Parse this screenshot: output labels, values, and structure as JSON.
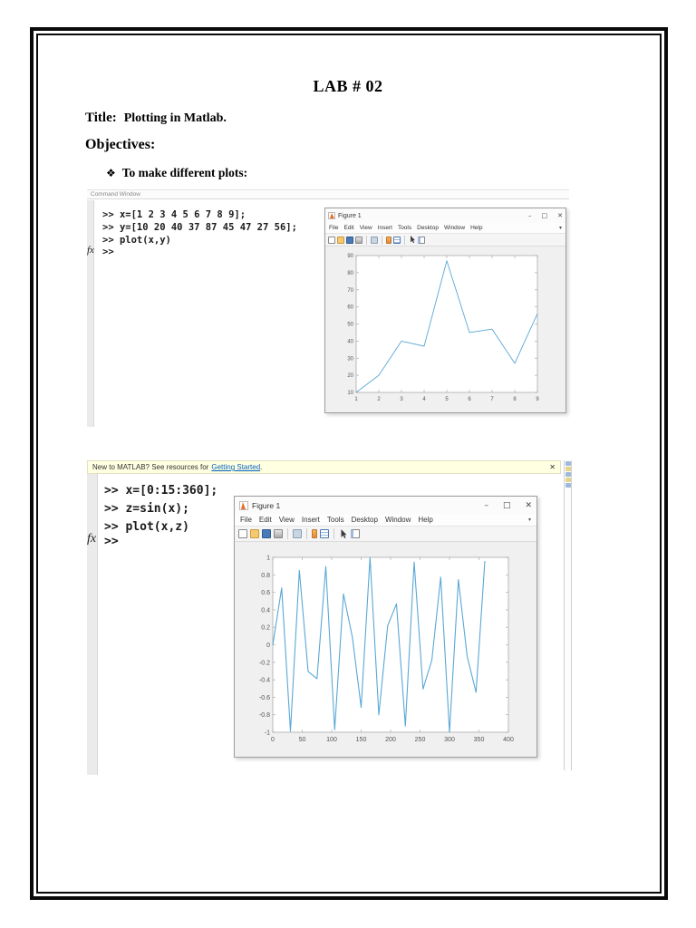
{
  "document": {
    "lab_title": "LAB # 02",
    "title_label": "Title",
    "title_colon": ":",
    "title_value": "Plotting in Matlab.",
    "objectives_label": "Objectives:",
    "bullet_symbol": "❖",
    "objective_item": "To make different plots:"
  },
  "shot1": {
    "command_window_label": "Command Window",
    "code_lines": [
      ">> x=[1 2 3 4 5 6 7 8 9];",
      ">> y=[10 20 40 37 87 45 47 27 56];",
      ">> plot(x,y)"
    ],
    "prompt": ">>",
    "fx_label": "fx"
  },
  "shot2": {
    "banner_text": "New to MATLAB? See resources for",
    "banner_link": "Getting Started",
    "banner_period": ".",
    "banner_close": "✕",
    "code_lines": [
      ">> x=[0:15:360];",
      ">> z=sin(x);",
      ">> plot(x,z)"
    ],
    "prompt": ">>",
    "fx_label": "fx"
  },
  "figure_window": {
    "title": "Figure 1",
    "menu": [
      "File",
      "Edit",
      "View",
      "Insert",
      "Tools",
      "Desktop",
      "Window",
      "Help"
    ],
    "minimize": "–",
    "maximize": "□",
    "close": "✕",
    "menu_overflow": "▾"
  },
  "colors": {
    "line_blue": "#5aa7d6",
    "banner_bg": "#ffffe1",
    "link_blue": "#0563c1",
    "axes_stroke": "#aaaaaa",
    "tick_text": "#555555"
  },
  "chart_data": [
    {
      "type": "line",
      "title": "",
      "xlabel": "",
      "ylabel": "",
      "x": [
        1,
        2,
        3,
        4,
        5,
        6,
        7,
        8,
        9
      ],
      "values": [
        10,
        20,
        40,
        37,
        87,
        45,
        47,
        27,
        56
      ],
      "xlim": [
        1,
        9
      ],
      "ylim": [
        10,
        90
      ],
      "xticks": [
        1,
        2,
        3,
        4,
        5,
        6,
        7,
        8,
        9
      ],
      "xtick_labels": [
        "1",
        "2",
        "3",
        "4",
        "5",
        "6",
        "7",
        "8",
        "9"
      ],
      "yticks": [
        10,
        20,
        30,
        40,
        50,
        60,
        70,
        80,
        90
      ],
      "ytick_labels": [
        "10",
        "20",
        "30",
        "40",
        "50",
        "60",
        "70",
        "80",
        "90"
      ],
      "grid": false,
      "legend": null,
      "line_width": 0.9
    },
    {
      "type": "line",
      "title": "",
      "xlabel": "",
      "ylabel": "",
      "x": [
        0,
        15,
        30,
        45,
        60,
        75,
        90,
        105,
        120,
        135,
        150,
        165,
        180,
        195,
        210,
        225,
        240,
        255,
        270,
        285,
        300,
        315,
        330,
        345,
        360
      ],
      "values": [
        0,
        0.65,
        -0.988,
        0.851,
        -0.305,
        -0.388,
        0.894,
        -0.971,
        0.581,
        0.088,
        -0.715,
        0.998,
        -0.801,
        0.219,
        0.468,
        -0.93,
        0.945,
        -0.506,
        -0.176,
        0.774,
        -1.0,
        0.745,
        -0.132,
        -0.544,
        0.959
      ],
      "xlim": [
        0,
        400
      ],
      "ylim": [
        -1,
        1
      ],
      "xticks": [
        0,
        50,
        100,
        150,
        200,
        250,
        300,
        350,
        400
      ],
      "xtick_labels": [
        "0",
        "50",
        "100",
        "150",
        "200",
        "250",
        "300",
        "350",
        "400"
      ],
      "yticks": [
        -1,
        -0.8,
        -0.6,
        -0.4,
        -0.2,
        0,
        0.2,
        0.4,
        0.6,
        0.8,
        1
      ],
      "ytick_labels": [
        "-1",
        "-0.8",
        "-0.6",
        "-0.4",
        "-0.2",
        "0",
        "0.2",
        "0.4",
        "0.6",
        "0.8",
        "1"
      ],
      "grid": false,
      "legend": null,
      "line_width": 1.1
    }
  ]
}
